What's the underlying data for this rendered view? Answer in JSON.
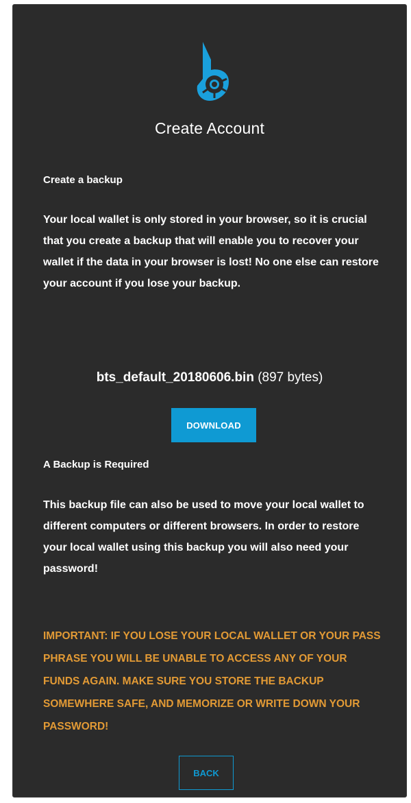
{
  "dialog": {
    "title": "Create Account",
    "backup_heading": "Create a backup",
    "backup_text_1": "Your local wallet is ",
    "backup_text_2": "only stored",
    "backup_text_3": " in your browser, so it is crucial that you create a backup that will enable you to recover your wallet if the data in your browser is lost! No one else can restore your account if you lose your backup.",
    "file_name": "bts_default_20180606.bin",
    "file_size": "(897 bytes)",
    "download_label": "DOWNLOAD",
    "required_heading": "A Backup is Required",
    "required_text": "This backup file can also be used to move your local wallet to different computers or different browsers. In order to restore your local wallet using this backup you will also need your password!",
    "important_text": "IMPORTANT: IF YOU LOSE YOUR LOCAL WALLET OR YOUR PASS PHRASE YOU WILL BE UNABLE TO ACCESS ANY OF YOUR FUNDS AGAIN. MAKE SURE YOU STORE THE BACKUP SOMEWHERE SAFE, AND MEMORIZE OR WRITE DOWN YOUR PASSWORD!",
    "back_label": "BACK"
  },
  "icons": {
    "logo": "bitshares-logo"
  },
  "colors": {
    "panel_bg": "#2b2b2b",
    "accent": "#0f9ad3",
    "warning": "#e29a35",
    "text": "#ffffff"
  }
}
